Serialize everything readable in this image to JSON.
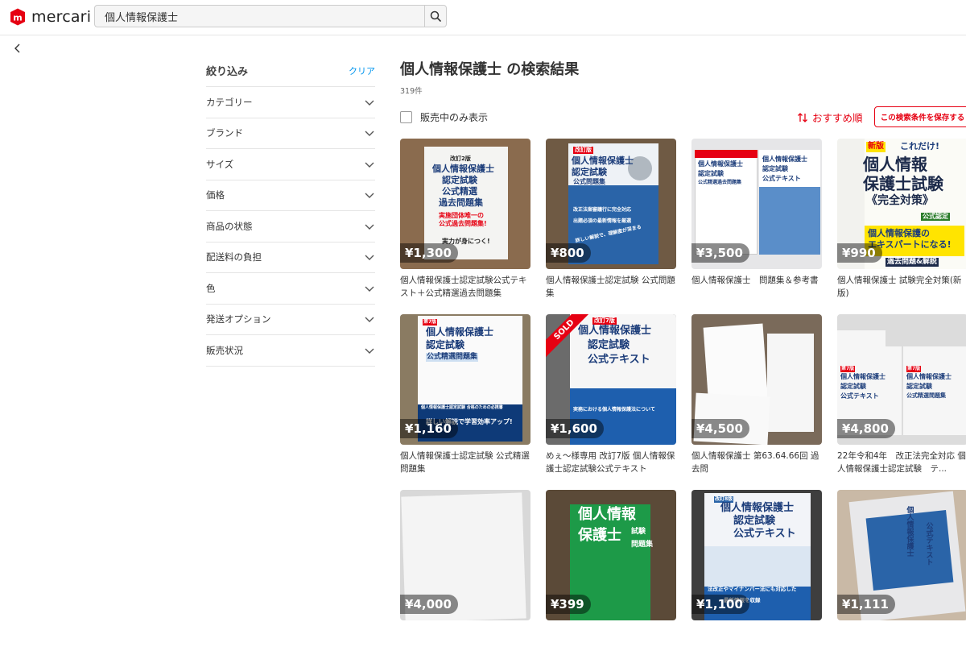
{
  "brand": {
    "name": "mercari",
    "accent": "#e60012"
  },
  "search": {
    "value": "個人情報保護士",
    "icon": "search-icon"
  },
  "sidebar": {
    "title": "絞り込み",
    "clear": "クリア",
    "filters": [
      {
        "label": "カテゴリー"
      },
      {
        "label": "ブランド"
      },
      {
        "label": "サイズ"
      },
      {
        "label": "価格"
      },
      {
        "label": "商品の状態"
      },
      {
        "label": "配送料の負担"
      },
      {
        "label": "色"
      },
      {
        "label": "発送オプション"
      },
      {
        "label": "販売状況"
      }
    ]
  },
  "results": {
    "title": "個人情報保護士 の検索結果",
    "count": "319件",
    "on_sale_only": "販売中のみ表示",
    "sort": "おすすめ順",
    "save_search": "この検索条件を保存する"
  },
  "items": [
    {
      "price": "¥1,300",
      "name": "個人情報保護士認定試験公式テキスト＋公式精選過去問題集",
      "sold": false
    },
    {
      "price": "¥800",
      "name": "個人情報保護士認定試験 公式問題集",
      "sold": false
    },
    {
      "price": "¥3,500",
      "name": "個人情報保護士　問題集＆参考書",
      "sold": false
    },
    {
      "price": "¥990",
      "name": "個人情報保護士 試験完全対策(新版)",
      "sold": false
    },
    {
      "price": "¥1,160",
      "name": "個人情報保護士認定試験 公式精選問題集",
      "sold": false
    },
    {
      "price": "¥1,600",
      "name": "めぇ～様専用 改訂7版 個人情報保護士認定試験公式テキスト",
      "sold": true,
      "sold_label": "SOLD"
    },
    {
      "price": "¥4,500",
      "name": "個人情報保護士 第63.64.66回 過去問",
      "sold": false
    },
    {
      "price": "¥4,800",
      "name": "22年令和4年　改正法完全対応 個人情報保護士認定試験　テ...",
      "sold": false
    },
    {
      "price": "¥4,000",
      "name": "",
      "sold": false
    },
    {
      "price": "¥399",
      "name": "",
      "sold": false
    },
    {
      "price": "¥1,100",
      "name": "",
      "sold": false
    },
    {
      "price": "¥1,111",
      "name": "",
      "sold": false
    }
  ],
  "book_texts": {
    "b1": [
      "改訂2版",
      "個人情報保護士",
      "認定試験",
      "公式精選",
      "過去問題集",
      "実施団体唯一の",
      "公式過去問題集!",
      "実力が身につく!"
    ],
    "b2": [
      "改訂版",
      "個人情報保護士",
      "認定試験",
      "公式問題集",
      "改正法案審議行に完全対応",
      "出題必須の最新情報を厳選",
      "詳しい解説で、理解度が深まる"
    ],
    "b3": [
      "個人情報保護士",
      "認定試験",
      "公式精選過去問題集",
      "公式テキスト"
    ],
    "b4": [
      "新版",
      "これだけ!",
      "個人情報",
      "保護士試験",
      "《完全対策》",
      "公式認定",
      "個人情報保護の",
      "エキスパートになる!",
      "過去問題&解説"
    ],
    "b5": [
      "第7版",
      "個人情報保護士",
      "認定試験",
      "公式精選問題集",
      "個人情報保護士認定試験 合格のための必携書",
      "詳しい解説で学習効率アップ!"
    ],
    "b6": [
      "改訂7版",
      "個人情報保護士",
      "認定試験",
      "公式テキスト",
      "実務における個人情報保護法について"
    ],
    "b8": [
      "第7版",
      "個人情報保護士",
      "認定試験",
      "公式テキスト",
      "公式精選問題集"
    ],
    "b10": [
      "個人情報",
      "保護士",
      "試験",
      "問題集"
    ],
    "b11": [
      "改訂8版",
      "個人情報保護士",
      "認定試験",
      "公式テキスト",
      "法改正やマイナンバー法にも対応した",
      "最新情報を収録"
    ],
    "b12": [
      "個人情報保護士",
      "公式テキスト"
    ]
  }
}
